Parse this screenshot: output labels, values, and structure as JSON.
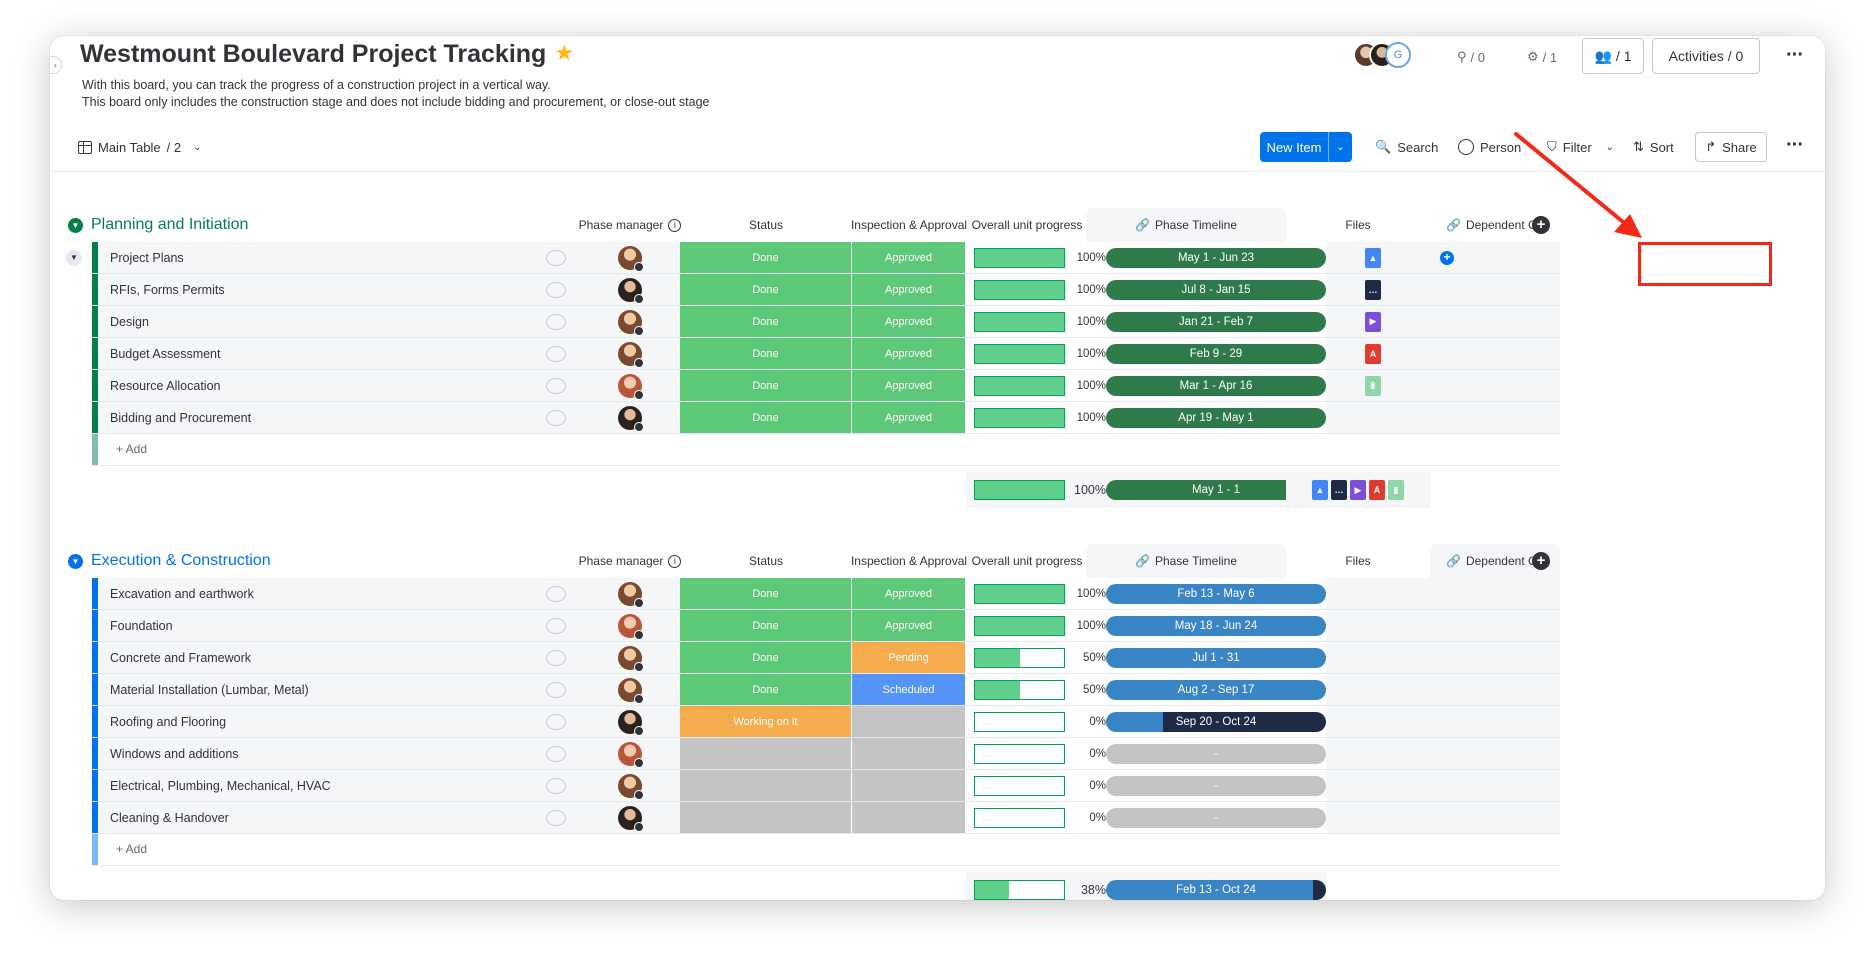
{
  "board": {
    "title": "Westmount Boulevard Project Tracking",
    "description_line1": "With this board, you can track the progress of a construction project in a vertical way.",
    "description_line2": "This board only includes the construction stage and does not include bidding and procurement, or close-out stage"
  },
  "header": {
    "guest_badge": "G",
    "automations_count": "/ 0",
    "integrations_count": "/ 1",
    "members_count": "/ 1",
    "activities_label": "Activities / 0"
  },
  "toolbar": {
    "view_label": "Main Table",
    "view_count": "/ 2",
    "new_item_label": "New Item",
    "search_label": "Search",
    "person_label": "Person",
    "filter_label": "Filter",
    "sort_label": "Sort",
    "share_label": "Share"
  },
  "columns": {
    "phase_manager": "Phase manager",
    "status": "Status",
    "inspection": "Inspection & Approval",
    "progress": "Overall unit progress",
    "timeline": "Phase Timeline",
    "files": "Files",
    "dependent": "Dependent On"
  },
  "colors": {
    "done": "#5cc878",
    "working": "#f5ac4d",
    "pending": "#f5ac4d",
    "scheduled": "#5494f6",
    "empty": "#c4c4c4",
    "group1": "#037f4c",
    "group2": "#0073ea",
    "timeline1": "#2f7a4b",
    "timeline2": "#3a85c6",
    "highlight": "#f52716"
  },
  "groups": [
    {
      "title": "Planning and Initiation",
      "add_label": "+ Add",
      "rows": [
        {
          "name": "Project Plans",
          "status": "Done",
          "inspection": "Approved",
          "progress": "100%",
          "timeline": "May 1 - Jun 23",
          "file": "drive"
        },
        {
          "name": "RFIs, Forms Permits",
          "status": "Done",
          "inspection": "Approved",
          "progress": "100%",
          "timeline": "Jul 8 - Jan 15",
          "file": "dots"
        },
        {
          "name": "Design",
          "status": "Done",
          "inspection": "Approved",
          "progress": "100%",
          "timeline": "Jan 21 - Feb 7",
          "file": "video"
        },
        {
          "name": "Budget Assessment",
          "status": "Done",
          "inspection": "Approved",
          "progress": "100%",
          "timeline": "Feb 9 - 29",
          "file": "pdf"
        },
        {
          "name": "Resource Allocation",
          "status": "Done",
          "inspection": "Approved",
          "progress": "100%",
          "timeline": "Mar 1 - Apr 16",
          "file": "sheet"
        },
        {
          "name": "Bidding and Procurement",
          "status": "Done",
          "inspection": "Approved",
          "progress": "100%",
          "timeline": "Apr 19 - May 1",
          "file": ""
        }
      ],
      "summary": {
        "progress": "100%",
        "timeline": "May 1 - 1"
      }
    },
    {
      "title": "Execution & Construction",
      "add_label": "+ Add",
      "rows": [
        {
          "name": "Excavation and earthwork",
          "status": "Done",
          "inspection": "Approved",
          "progress": "100%",
          "timeline": "Feb 13 - May 6"
        },
        {
          "name": "Foundation",
          "status": "Done",
          "inspection": "Approved",
          "progress": "100%",
          "timeline": "May 18 - Jun 24"
        },
        {
          "name": "Concrete and Framework",
          "status": "Done",
          "inspection": "Pending",
          "progress": "50%",
          "timeline": "Jul 1 - 31"
        },
        {
          "name": "Material Installation (Lumbar, Metal)",
          "status": "Done",
          "inspection": "Scheduled",
          "progress": "50%",
          "timeline": "Aug 2 - Sep 17"
        },
        {
          "name": "Roofing and Flooring",
          "status": "Working on it",
          "inspection": "",
          "progress": "0%",
          "timeline": "Sep 20 - Oct 24"
        },
        {
          "name": "Windows and additions",
          "status": "",
          "inspection": "",
          "progress": "0%",
          "timeline": "-"
        },
        {
          "name": "Electrical, Plumbing, Mechanical, HVAC",
          "status": "",
          "inspection": "",
          "progress": "0%",
          "timeline": "-"
        },
        {
          "name": "Cleaning & Handover",
          "status": "",
          "inspection": "",
          "progress": "0%",
          "timeline": "-"
        }
      ],
      "summary": {
        "progress": "38%",
        "timeline": "Feb 13 - Oct 24"
      }
    }
  ]
}
